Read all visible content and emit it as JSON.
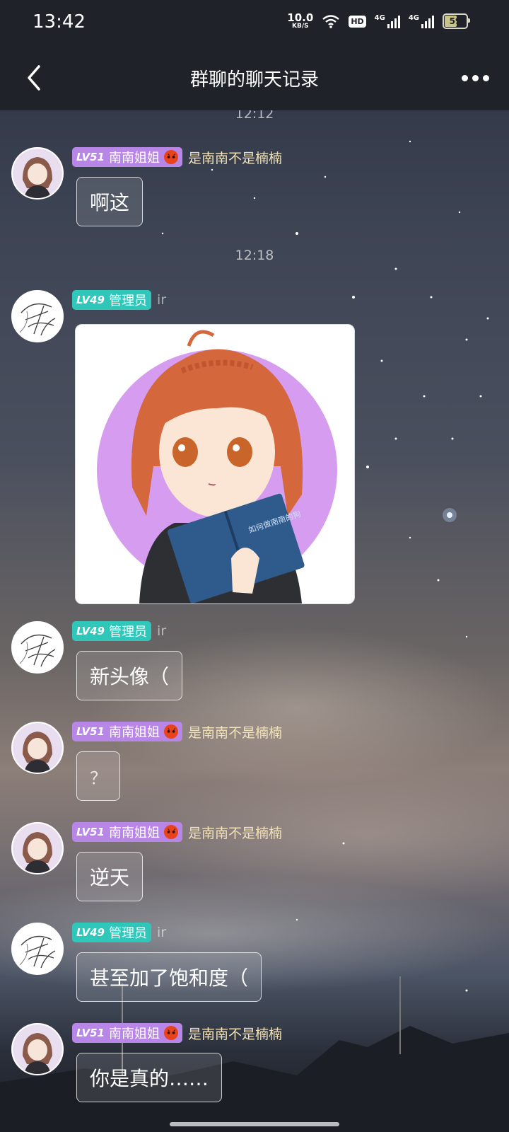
{
  "status_bar": {
    "time": "13:42",
    "speed_value": "10.0",
    "speed_unit": "KB/S",
    "hd_label": "HD",
    "net_label": "4G",
    "battery_percent": "59",
    "battery_level": 59
  },
  "header": {
    "title": "群聊的聊天记录",
    "back_icon": "back-arrow-icon",
    "menu_icon": "more-dots-icon"
  },
  "timestamps": [
    "12:12",
    "12:18"
  ],
  "users": {
    "nannan": {
      "level": "LV51",
      "title_tag": "南南姐姐",
      "nickname": "是南南不是楠楠",
      "tag_color": "#b886e6"
    },
    "admin": {
      "level": "LV49",
      "title_tag": "管理员",
      "nickname": "ir",
      "tag_color": "#2ec7b9"
    }
  },
  "messages": [
    {
      "user": "nannan",
      "text": "啊这"
    },
    {
      "user": "admin",
      "type": "image",
      "book_text": "如何做南南的狗"
    },
    {
      "user": "admin",
      "text": "新头像（"
    },
    {
      "user": "nannan",
      "text": "？"
    },
    {
      "user": "nannan",
      "text": "逆天"
    },
    {
      "user": "admin",
      "text": "甚至加了饱和度（"
    },
    {
      "user": "nannan",
      "text": "你是真的……"
    }
  ],
  "colors": {
    "header_bg": "#1f2229",
    "nickname_gold": "#f2e2b9"
  }
}
